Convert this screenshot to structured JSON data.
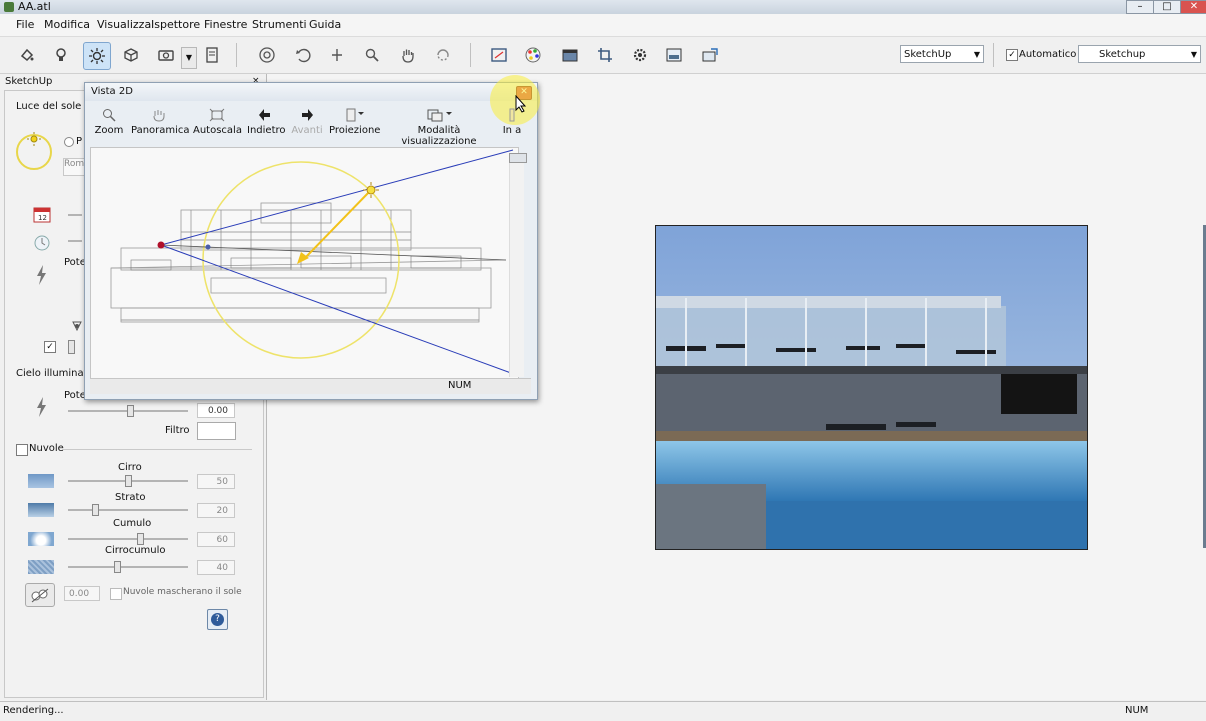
{
  "window": {
    "title": "AA.atl"
  },
  "menu": [
    "File",
    "Modifica",
    "Visualizza",
    "Ispettore",
    "Finestre",
    "Strumenti",
    "Guida"
  ],
  "toolbar": {
    "renderer_select": "SketchUp",
    "auto_checkbox_label": "Automatico",
    "auto_checked": "✓",
    "environment_select": "Sketchup"
  },
  "panel": {
    "tab_title": "SketchUp",
    "sun_section": "Luce del sole",
    "sun_option_clipped": "P",
    "sun_field_clipped": "Rom",
    "power_label_clipped": "Pote",
    "sun_check": "✓",
    "sky_section": "Cielo illuminato",
    "sky_power_clipped": "Potei",
    "sky_power_value": "0.00",
    "filter_label": "Filtro",
    "clouds_label": "Nuvole",
    "cirrus_label": "Cirro",
    "cirrus_value": "50",
    "stratus_label": "Strato",
    "stratus_value": "20",
    "cumulus_label": "Cumulo",
    "cumulus_value": "60",
    "cirrocumulus_label": "Cirrocumulo",
    "cirrocumulus_value": "40",
    "cloud_offset_value": "0.00",
    "mask_sun_label": "Nuvole mascherano il sole",
    "help_glyph": "?"
  },
  "vista2d": {
    "title": "Vista 2D",
    "tools": [
      "Zoom",
      "Panoramica",
      "Autoscala",
      "Indietro",
      "Avanti",
      "Proiezione",
      "Modalità visualizzazione",
      "In a"
    ],
    "status_num": "NUM"
  },
  "statusbar": {
    "left_text": "Rendering...",
    "right_text": "NUM"
  },
  "colors": {
    "accent": "#cde3f7",
    "sun_yellow": "#f2d21a",
    "sight_line": "#2a3db8",
    "camera_dot": "#b0102a"
  }
}
